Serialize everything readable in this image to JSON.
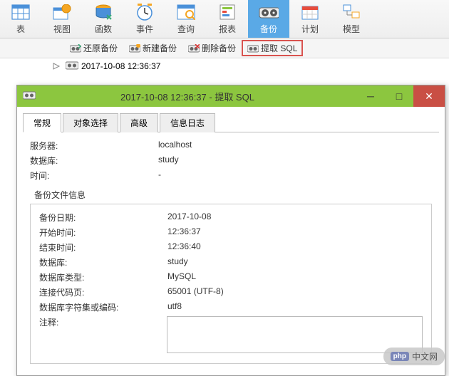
{
  "toolbar": [
    {
      "label": "表",
      "name": "table"
    },
    {
      "label": "视图",
      "name": "view"
    },
    {
      "label": "函数",
      "name": "function"
    },
    {
      "label": "事件",
      "name": "event"
    },
    {
      "label": "查询",
      "name": "query"
    },
    {
      "label": "报表",
      "name": "report"
    },
    {
      "label": "备份",
      "name": "backup",
      "active": true
    },
    {
      "label": "计划",
      "name": "schedule"
    },
    {
      "label": "模型",
      "name": "model"
    }
  ],
  "subtoolbar": {
    "restore": "还原备份",
    "new": "新建备份",
    "delete": "删除备份",
    "extract": "提取 SQL"
  },
  "backup_item": "2017-10-08 12:36:37",
  "dialog": {
    "title": "2017-10-08 12:36:37 - 提取 SQL",
    "tabs": [
      "常规",
      "对象选择",
      "高级",
      "信息日志"
    ],
    "server_label": "服务器:",
    "server_value": "localhost",
    "database_label": "数据库:",
    "database_value": "study",
    "time_label": "时间:",
    "time_value": "-",
    "group_title": "备份文件信息",
    "backup_date_label": "备份日期:",
    "backup_date_value": "2017-10-08",
    "start_time_label": "开始时间:",
    "start_time_value": "12:36:37",
    "end_time_label": "结束时间:",
    "end_time_value": "12:36:40",
    "db_label": "数据库:",
    "db_value": "study",
    "db_type_label": "数据库类型:",
    "db_type_value": "MySQL",
    "codepage_label": "连接代码页:",
    "codepage_value": "65001 (UTF-8)",
    "charset_label": "数据库字符集或编码:",
    "charset_value": "utf8",
    "comment_label": "注释:"
  },
  "watermark": {
    "badge": "php",
    "text": "中文网"
  }
}
